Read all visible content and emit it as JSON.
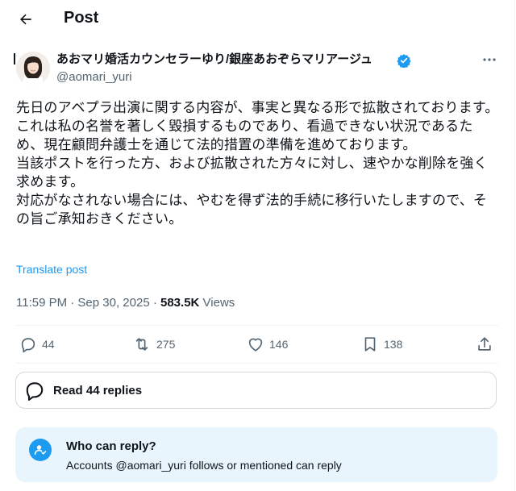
{
  "header": {
    "title": "Post"
  },
  "author": {
    "display_name": "あおマリ婚活カウンセラーゆり/銀座あおぞらマリアージュ",
    "handle": "@aomari_yuri",
    "verified": true
  },
  "post": {
    "lines": [
      "先日のアベプラ出演に関する内容が、事実と異なる形で拡散されております。",
      "これは私の名誉を著しく毀損するものであり、看過できない状況であるため、現在顧問弁護士を通じて法的措置の準備を進めております。",
      "当該ポストを行った方、および拡散された方々に対し、速やかな削除を強く求めます。",
      "対応がなされない場合には、やむを得ず法的手続に移行いたしますので、その旨ご承知おきください。"
    ],
    "translate_label": "Translate post"
  },
  "meta": {
    "time": "11:59 PM · Sep 30, 2025 · ",
    "views_count": "583.5K",
    "views_label": " Views"
  },
  "actions": {
    "replies": "44",
    "reposts": "275",
    "likes": "146",
    "bookmarks": "138"
  },
  "replies_button": {
    "label": "Read 44 replies"
  },
  "who_can_reply": {
    "title": "Who can reply?",
    "description": "Accounts @aomari_yuri follows or mentioned can reply"
  },
  "colors": {
    "accent": "#1d9bf0",
    "text": "#0f1419",
    "secondary": "#536471",
    "card_bg": "#e8f5fd"
  }
}
